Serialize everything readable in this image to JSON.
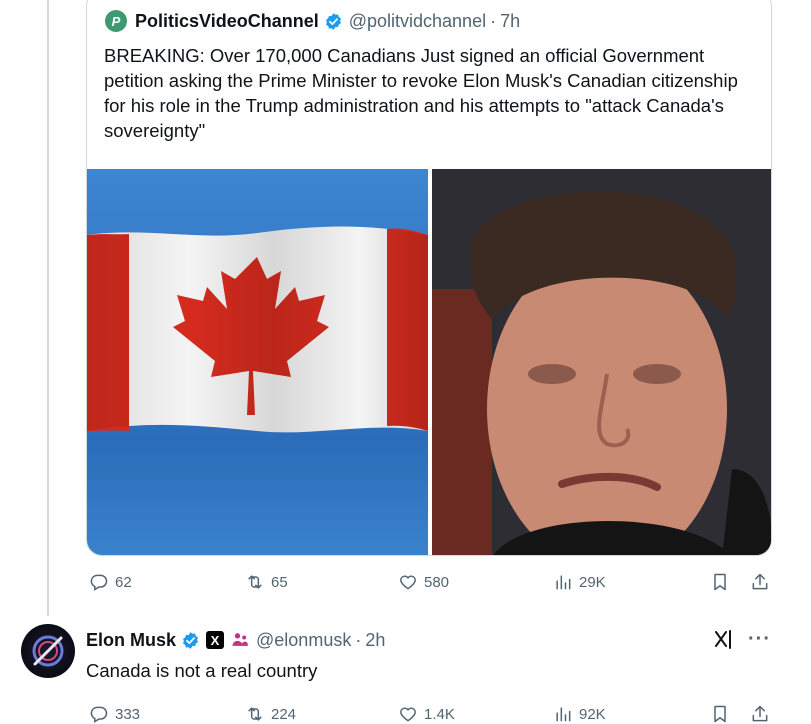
{
  "quoted_post": {
    "author_name": "PoliticsVideoChannel",
    "avatar_letter": "P",
    "handle": "@politvidchannel",
    "separator": "·",
    "time": "7h",
    "text": "BREAKING: Over 170,000 Canadians Just signed an official Government petition asking the Prime Minister to revoke Elon Musk's Canadian citizenship for his role in the Trump administration and his attempts to \"attack Canada's sovereignty\"",
    "stats": {
      "replies": "62",
      "reposts": "65",
      "likes": "580",
      "views": "29K"
    }
  },
  "reply_post": {
    "author_name": "Elon Musk",
    "x_badge": "X",
    "handle": "@elonmusk",
    "separator": "·",
    "time": "2h",
    "text": "Canada is not a real country",
    "more": "···",
    "stats": {
      "replies": "333",
      "reposts": "224",
      "likes": "1.4K",
      "views": "92K"
    }
  },
  "colors": {
    "verified": "#1d9bf0",
    "secondary_text": "#536471",
    "flag_red": "#d52b1e",
    "affiliate_pink": "#c13584"
  }
}
